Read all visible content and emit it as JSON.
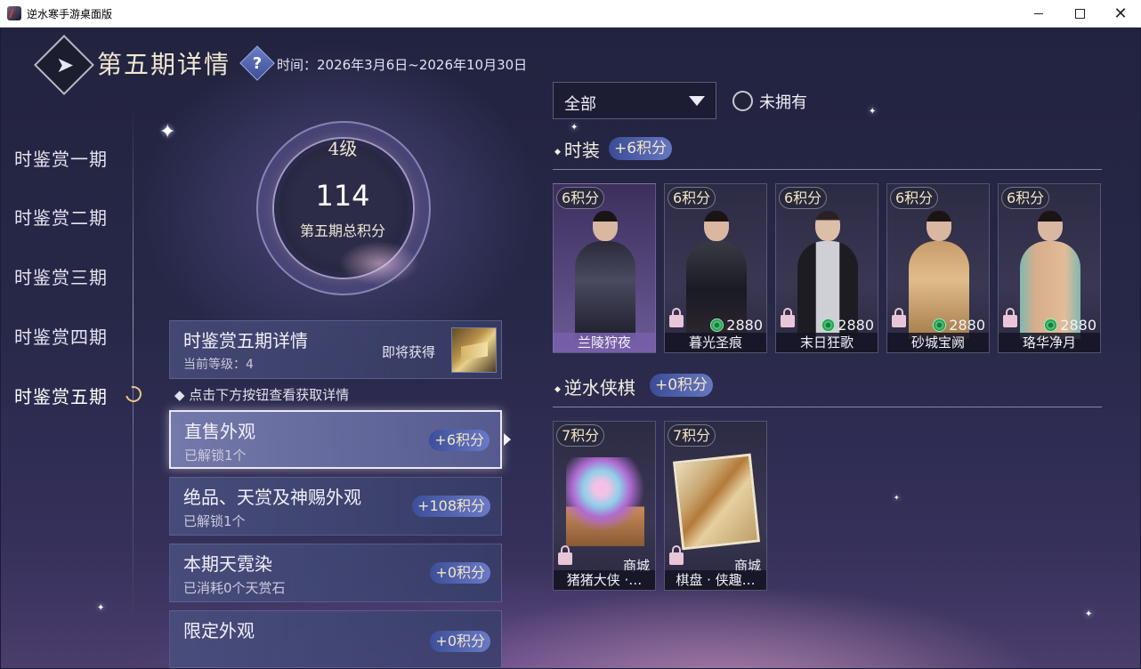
{
  "window": {
    "title": "逆水寒手游桌面版",
    "controls": {
      "close": "✕"
    }
  },
  "header": {
    "title": "第五期详情",
    "help": "?",
    "time": "时间：2026年3月6日~2026年10月30日"
  },
  "nav": {
    "items": [
      {
        "label": "时鉴赏一期"
      },
      {
        "label": "时鉴赏二期"
      },
      {
        "label": "时鉴赏三期"
      },
      {
        "label": "时鉴赏四期"
      },
      {
        "label": "时鉴赏五期",
        "active": true
      }
    ]
  },
  "score": {
    "level": "4级",
    "value": "114",
    "label": "第五期总积分"
  },
  "detail": {
    "title": "时鉴赏五期详情",
    "level": "当前等级：4",
    "soon": "即将获得"
  },
  "hint": "◆ 点击下方按钮查看获取详情",
  "categories": [
    {
      "title": "直售外观",
      "sub": "已解锁1个",
      "badge": "+6积分",
      "active": true
    },
    {
      "title": "绝品、天赏及神赐外观",
      "sub": "已解锁1个",
      "badge": "+108积分"
    },
    {
      "title": "本期天霓染",
      "sub": "已消耗0个天赏石",
      "badge": "+0积分"
    },
    {
      "title": "限定外观",
      "sub": "",
      "badge": "+0积分"
    }
  ],
  "filter": {
    "selected": "全部",
    "unowned_label": "未拥有",
    "unowned_checked": false
  },
  "sections": [
    {
      "title": "时装",
      "badge": "+6积分",
      "items": [
        {
          "points": "6积分",
          "name": "兰陵狩夜",
          "price": "",
          "source": "",
          "owned": true
        },
        {
          "points": "6积分",
          "name": "暮光圣痕",
          "price": "2880",
          "source": "",
          "owned": false
        },
        {
          "points": "6积分",
          "name": "末日狂歌",
          "price": "2880",
          "source": "",
          "owned": false
        },
        {
          "points": "6积分",
          "name": "砂城宝阙",
          "price": "2880",
          "source": "",
          "owned": false
        },
        {
          "points": "6积分",
          "name": "珞华净月",
          "price": "2880",
          "source": "",
          "owned": false
        }
      ]
    },
    {
      "title": "逆水侠棋",
      "badge": "+0积分",
      "items": [
        {
          "points": "7积分",
          "name": "猪猪大侠 ·…",
          "price": "",
          "source": "商城",
          "owned": false
        },
        {
          "points": "7积分",
          "name": "棋盘 · 侠趣…",
          "price": "",
          "source": "商城",
          "owned": false
        }
      ]
    }
  ],
  "colors": {
    "accent": "#6677c2",
    "points_text": "#f3e5c2",
    "coin": "#58d488",
    "lock": "#e8c6d8"
  }
}
